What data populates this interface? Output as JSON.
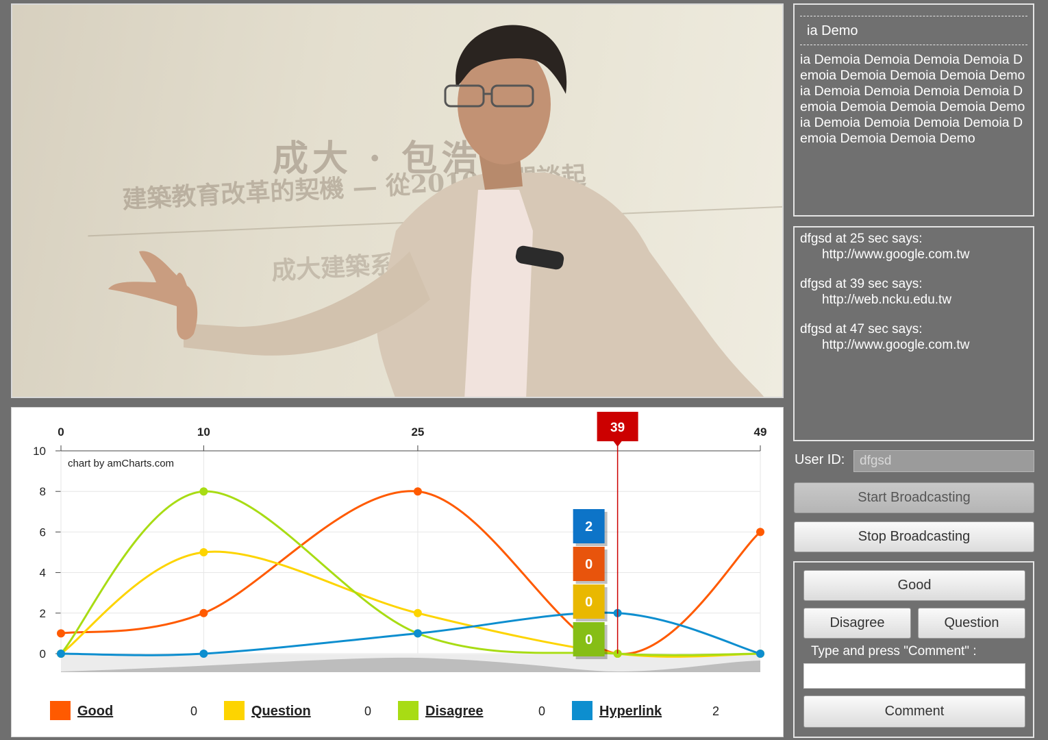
{
  "video": {
    "screen_title": "成大 · 包浩",
    "screen_subtitle": "建築教育改革的契機 — 從2010 訪問談起",
    "screen_subtitle2": "成大建築系"
  },
  "description": {
    "title": "ia Demo",
    "body": "ia Demoia Demoia Demoia Demoia Demoia Demoia Demoia Demoia Demoia Demoia Demoia Demoia Demoia Demoia Demoia Demoia Demoia Demoia Demoia Demoia Demoia Demoia Demoia Demoia Demoia Demo"
  },
  "comments": [
    {
      "header": "dfgsd at 25 sec says:",
      "link": "http://www.google.com.tw"
    },
    {
      "header": "dfgsd at 39 sec says:",
      "link": "http://web.ncku.edu.tw"
    },
    {
      "header": "dfgsd at 47 sec says:",
      "link": "http://www.google.com.tw"
    }
  ],
  "user": {
    "label": "User ID:",
    "value": "dfgsd"
  },
  "buttons": {
    "start": "Start Broadcasting",
    "stop": "Stop Broadcasting",
    "good": "Good",
    "disagree": "Disagree",
    "question": "Question",
    "comment_prompt": "Type and press \"Comment\" :",
    "comment": "Comment"
  },
  "chart_data": {
    "type": "line",
    "credit": "chart by amCharts.com",
    "x": [
      0,
      10,
      25,
      39,
      49
    ],
    "x_ticks": [
      0,
      10,
      25,
      49
    ],
    "ylim": [
      0,
      10
    ],
    "y_ticks": [
      0,
      2,
      4,
      6,
      8,
      10
    ],
    "cursor": {
      "x": 39,
      "label": "39"
    },
    "series": [
      {
        "name": "Good",
        "color": "#ff5a00",
        "points": [
          [
            0,
            1
          ],
          [
            10,
            2
          ],
          [
            25,
            8
          ],
          [
            39,
            0
          ],
          [
            49,
            6
          ]
        ],
        "value": 0
      },
      {
        "name": "Question",
        "color": "#fdd400",
        "points": [
          [
            0,
            0
          ],
          [
            10,
            5
          ],
          [
            25,
            2
          ],
          [
            39,
            0
          ],
          [
            49,
            0
          ]
        ],
        "value": 0
      },
      {
        "name": "Disagree",
        "color": "#a8dc14",
        "points": [
          [
            0,
            0
          ],
          [
            10,
            8
          ],
          [
            25,
            1
          ],
          [
            39,
            0
          ],
          [
            49,
            0
          ]
        ],
        "value": 0
      },
      {
        "name": "Hyperlink",
        "color": "#0d8ecf",
        "points": [
          [
            0,
            0
          ],
          [
            10,
            0
          ],
          [
            25,
            1
          ],
          [
            39,
            2
          ],
          [
            49,
            0
          ]
        ],
        "value": 2
      }
    ],
    "balloons": [
      {
        "series": "Hyperlink",
        "value": "2",
        "color": "#0d74c8"
      },
      {
        "series": "Good",
        "value": "0",
        "color": "#e8540c"
      },
      {
        "series": "Question",
        "value": "0",
        "color": "#e9b800"
      },
      {
        "series": "Disagree",
        "value": "0",
        "color": "#86be16"
      }
    ],
    "legend_position": "bottom"
  }
}
